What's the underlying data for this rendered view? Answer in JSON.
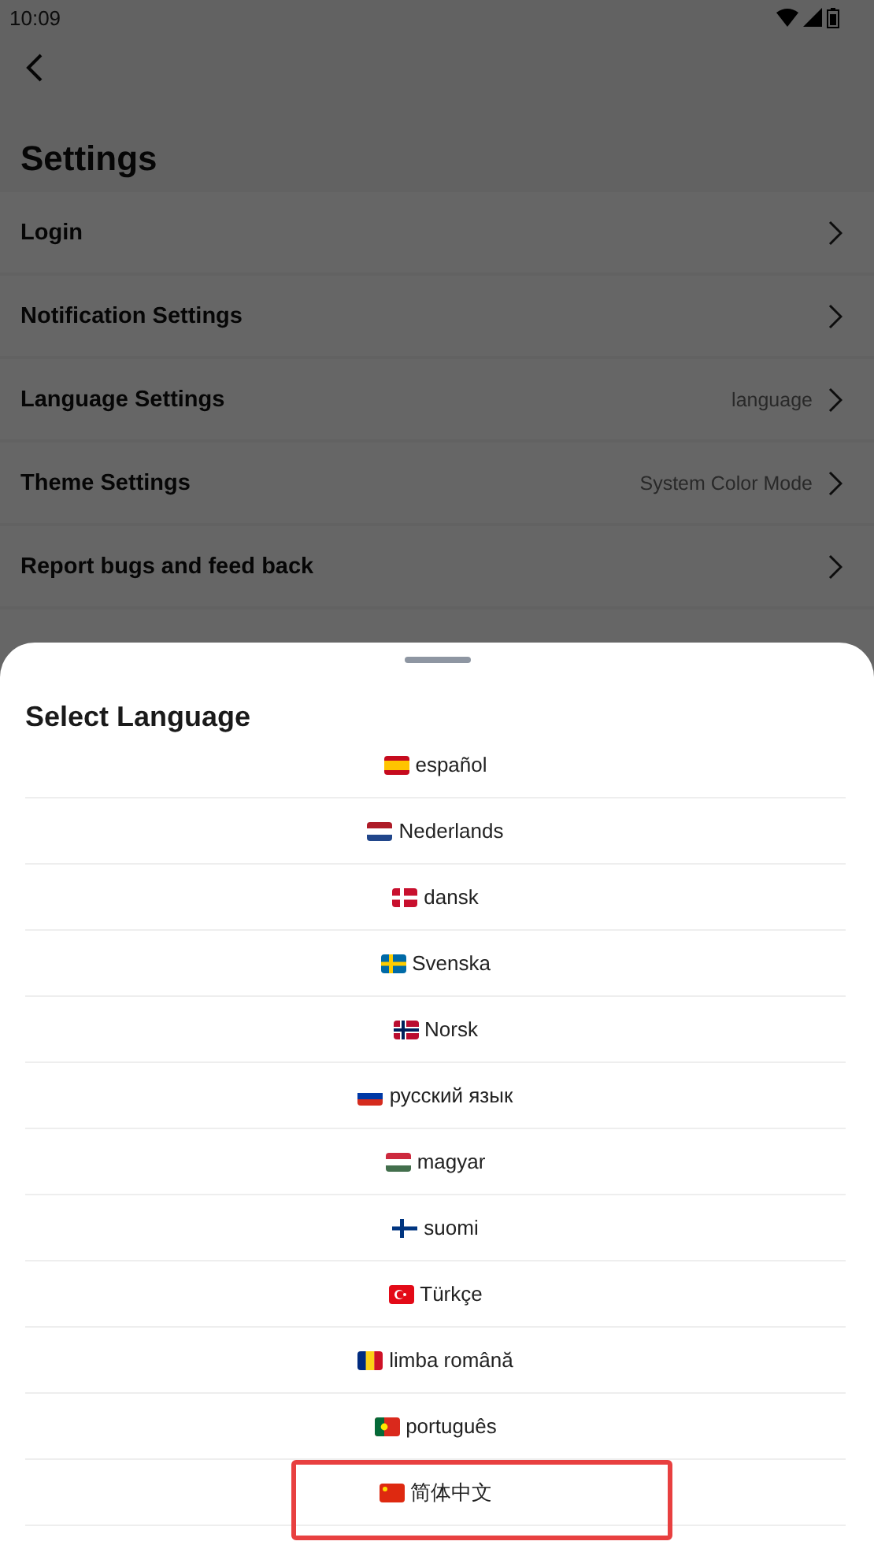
{
  "status_bar": {
    "time": "10:09"
  },
  "page": {
    "title": "Settings",
    "rows": [
      {
        "label": "Login"
      },
      {
        "label": "Notification Settings"
      },
      {
        "label": "Language Settings",
        "value": "language"
      },
      {
        "label": "Theme Settings",
        "value": "System Color Mode"
      },
      {
        "label": "Report bugs and feed back"
      }
    ]
  },
  "sheet": {
    "title": "Select Language",
    "languages": [
      {
        "kind": "es",
        "label": "español",
        "highlighted": false
      },
      {
        "kind": "nl",
        "label": "Nederlands",
        "highlighted": false
      },
      {
        "kind": "dk",
        "label": "dansk",
        "highlighted": false
      },
      {
        "kind": "se",
        "label": "Svenska",
        "highlighted": false
      },
      {
        "kind": "no",
        "label": "Norsk",
        "highlighted": false
      },
      {
        "kind": "ru",
        "label": "русский язык",
        "highlighted": false
      },
      {
        "kind": "hu",
        "label": "magyar",
        "highlighted": false
      },
      {
        "kind": "fi",
        "label": "suomi",
        "highlighted": false
      },
      {
        "kind": "tr",
        "label": "Türkçe",
        "highlighted": false
      },
      {
        "kind": "ro",
        "label": "limba română",
        "highlighted": false
      },
      {
        "kind": "pt",
        "label": "português",
        "highlighted": false
      },
      {
        "kind": "cn",
        "label": "简体中文",
        "highlighted": true
      }
    ]
  }
}
